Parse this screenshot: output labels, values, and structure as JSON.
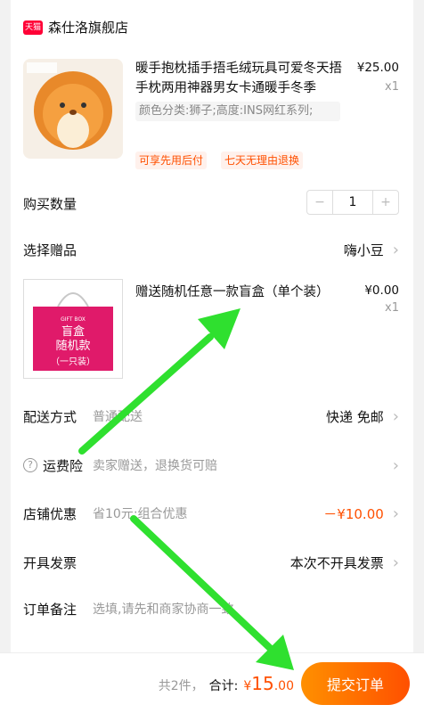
{
  "store": {
    "badge": "天猫",
    "name": "森仕洛旗舰店"
  },
  "product": {
    "title": "暖手抱枕插手捂毛绒玩具可爱冬天捂手枕两用神器男女卡通暖手冬季",
    "price": "¥25.00",
    "qty": "x1",
    "spec": "颜色分类:狮子;高度:INS网红系列;",
    "tags": [
      "可享先用后付",
      "七天无理由退换"
    ]
  },
  "quantity": {
    "label": "购买数量",
    "value": "1",
    "minus": "−",
    "plus": "+"
  },
  "gift_select": {
    "label": "选择赠品",
    "value": "嗨小豆"
  },
  "gift": {
    "title": "赠送随机任意一款盲盒（单个装）",
    "price": "¥0.00",
    "qty": "x1",
    "box_line1": "GIFT BOX",
    "box_line2": "盲盒",
    "box_line3": "随机款",
    "box_line4": "（一只装）"
  },
  "shipping": {
    "label": "配送方式",
    "sub": "普通配送",
    "value": "快递 免邮"
  },
  "insurance": {
    "label": "运费险",
    "sub": "卖家赠送，退换货可赔"
  },
  "discount": {
    "label": "店铺优惠",
    "sub": "省10元:组合优惠",
    "value": "－¥10.00"
  },
  "invoice": {
    "label": "开具发票",
    "value": "本次不开具发票"
  },
  "note": {
    "label": "订单备注",
    "placeholder": "选填,请先和商家协商一致"
  },
  "footer": {
    "count": "共2件，",
    "total_label": "合计:",
    "currency": "¥",
    "total": "15",
    "cents": ".00",
    "submit": "提交订单"
  },
  "colors": {
    "accent": "#ff5000",
    "arrow": "#2fe02f",
    "tmall": "#ff0036"
  }
}
